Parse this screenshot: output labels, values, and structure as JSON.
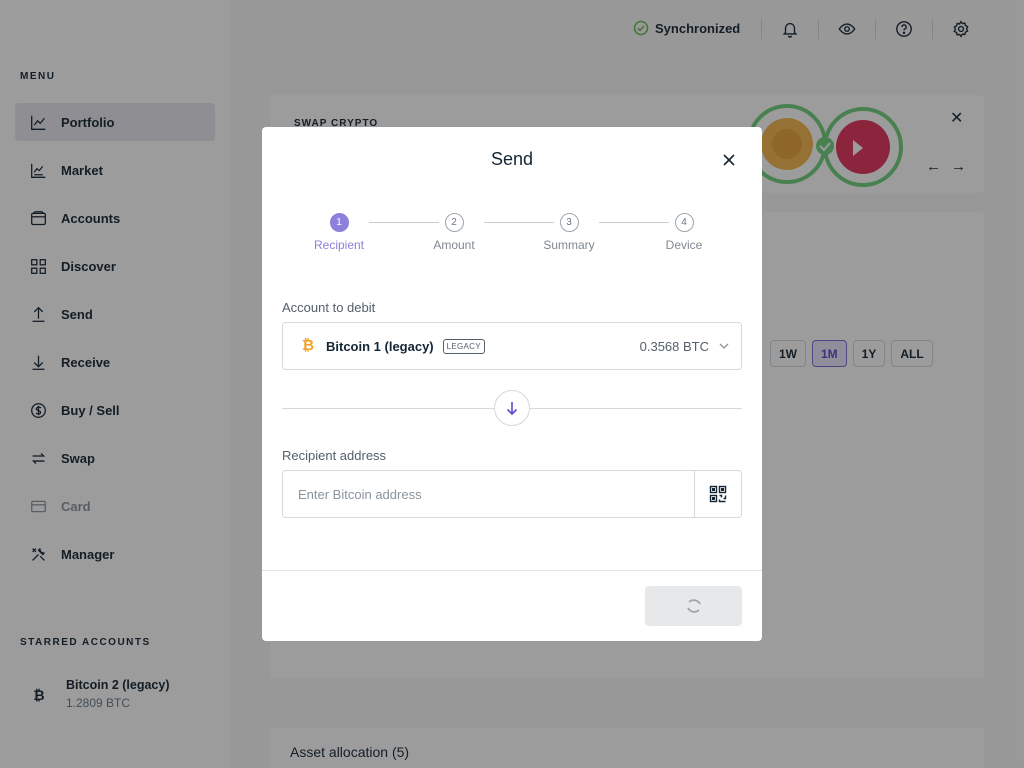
{
  "sidebar": {
    "menu_title": "MENU",
    "items": [
      {
        "label": "Portfolio",
        "icon": "chart-line-icon"
      },
      {
        "label": "Market",
        "icon": "market-icon"
      },
      {
        "label": "Accounts",
        "icon": "wallet-icon"
      },
      {
        "label": "Discover",
        "icon": "grid-icon"
      },
      {
        "label": "Send",
        "icon": "send-arrow-up-icon"
      },
      {
        "label": "Receive",
        "icon": "receive-arrow-down-icon"
      },
      {
        "label": "Buy / Sell",
        "icon": "dollar-circle-icon"
      },
      {
        "label": "Swap",
        "icon": "swap-arrows-icon"
      },
      {
        "label": "Card",
        "icon": "card-icon"
      },
      {
        "label": "Manager",
        "icon": "tools-icon"
      }
    ],
    "active_item": "Portfolio",
    "disabled_item": "Card",
    "starred_title": "STARRED ACCOUNTS",
    "starred_accounts": [
      {
        "name": "Bitcoin 2 (legacy)",
        "balance": "1.2809 BTC",
        "icon": "bitcoin-icon"
      }
    ]
  },
  "topbar": {
    "sync_status": "Synchronized",
    "icons": [
      "bell-icon",
      "eye-icon",
      "help-icon",
      "settings-icon"
    ]
  },
  "background": {
    "swap_banner_title": "SWAP CRYPTO",
    "range_buttons": [
      "1W",
      "1M",
      "1Y",
      "ALL"
    ],
    "active_range": "1M",
    "asset_allocation": "Asset allocation (5)"
  },
  "modal": {
    "title": "Send",
    "steps": [
      {
        "number": "1",
        "label": "Recipient"
      },
      {
        "number": "2",
        "label": "Amount"
      },
      {
        "number": "3",
        "label": "Summary"
      },
      {
        "number": "4",
        "label": "Device"
      }
    ],
    "active_step": 1,
    "account_label": "Account to debit",
    "account": {
      "name": "Bitcoin 1 (legacy)",
      "badge": "LEGACY",
      "balance": "0.3568 BTC"
    },
    "recipient_label": "Recipient address",
    "recipient_placeholder": "Enter Bitcoin address",
    "recipient_value": "",
    "colors": {
      "accent": "#8b80db",
      "bitcoin": "#f2a12a",
      "sync_green": "#66be54"
    }
  }
}
